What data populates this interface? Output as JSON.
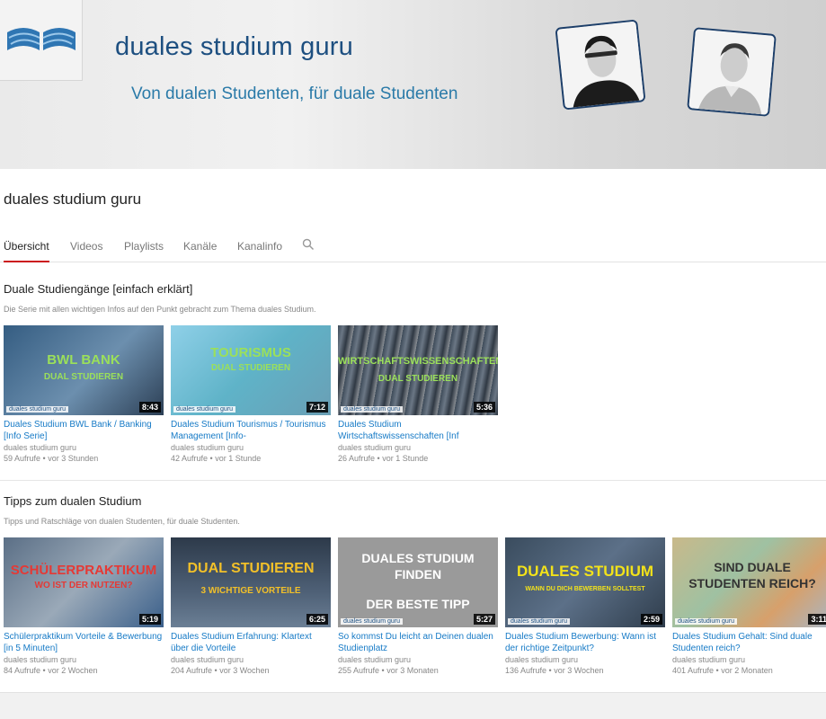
{
  "banner": {
    "brand": "duales studium guru",
    "slogan": "Von dualen Studenten, für duale Studenten"
  },
  "channel": {
    "title": "duales studium guru"
  },
  "tabs": [
    {
      "label": "Übersicht"
    },
    {
      "label": "Videos"
    },
    {
      "label": "Playlists"
    },
    {
      "label": "Kanäle"
    },
    {
      "label": "Kanalinfo"
    }
  ],
  "sections": [
    {
      "title": "Duale Studiengänge [einfach erklärt]",
      "description": "Die Serie mit allen wichtigen Infos auf den Punkt gebracht zum Thema duales Studium.",
      "videos": [
        {
          "thumb_line1": "BWL BANK",
          "thumb_line2": "DUAL STUDIEREN",
          "duration": "8:43",
          "thumb_mark": "duales studium guru",
          "title": "Duales Studium BWL Bank / Banking [Info Serie]",
          "channel": "duales studium guru",
          "views": "59 Aufrufe",
          "age": "vor 3 Stunden"
        },
        {
          "thumb_line1": "TOURISMUS",
          "thumb_line2": "DUAL STUDIEREN",
          "duration": "7:12",
          "thumb_mark": "duales studium guru",
          "title": "Duales Studium Tourismus / Tourismus Management [Info-",
          "channel": "duales studium guru",
          "views": "42 Aufrufe",
          "age": "vor 1 Stunde"
        },
        {
          "thumb_line1": "WIRTSCHAFTSWISSENSCHAFTEN",
          "thumb_line2": "DUAL STUDIEREN",
          "duration": "5:36",
          "thumb_mark": "duales studium guru",
          "title": "Duales Studium Wirtschaftswissenschaften [Inf",
          "channel": "duales studium guru",
          "views": "26 Aufrufe",
          "age": "vor 1 Stunde"
        }
      ]
    },
    {
      "title": "Tipps zum dualen Studium",
      "description": "Tipps und Ratschläge von dualen Studenten, für duale Studenten.",
      "videos": [
        {
          "thumb_line1": "SCHÜLERPRAKTIKUM",
          "thumb_line2": "WO IST DER NUTZEN?",
          "duration": "5:19",
          "thumb_mark": "",
          "title": "Schülerpraktikum Vorteile & Bewerbung [in 5 Minuten]",
          "channel": "duales studium guru",
          "views": "84 Aufrufe",
          "age": "vor 2 Wochen"
        },
        {
          "thumb_line1": "DUAL STUDIEREN",
          "thumb_line2": "3 WICHTIGE VORTEILE",
          "duration": "6:25",
          "thumb_mark": "",
          "title": "Duales Studium Erfahrung: Klartext über die Vorteile",
          "channel": "duales studium guru",
          "views": "204 Aufrufe",
          "age": "vor 3 Wochen"
        },
        {
          "thumb_line1": "DUALES STUDIUM FINDEN",
          "thumb_line2": "DER BESTE TIPP",
          "duration": "5:27",
          "thumb_mark": "duales studium guru",
          "title": "So kommst Du leicht an Deinen dualen Studienplatz",
          "channel": "duales studium guru",
          "views": "255 Aufrufe",
          "age": "vor 3 Monaten"
        },
        {
          "thumb_line1": "DUALES STUDIUM",
          "thumb_line2": "WANN DU DICH BEWERBEN SOLLTEST",
          "duration": "2:59",
          "thumb_mark": "duales studium guru",
          "title": "Duales Studium Bewerbung: Wann ist der richtige Zeitpunkt?",
          "channel": "duales studium guru",
          "views": "136 Aufrufe",
          "age": "vor 3 Wochen"
        },
        {
          "thumb_line1": "SIND DUALE STUDENTEN REICH?",
          "thumb_line2": "",
          "duration": "3:11",
          "thumb_mark": "duales studium guru",
          "title": "Duales Studium Gehalt: Sind duale Studenten reich?",
          "channel": "duales studium guru",
          "views": "401 Aufrufe",
          "age": "vor 2 Monaten"
        }
      ]
    }
  ],
  "colors": {
    "brand": "#1d4f80",
    "slogan": "#2a7aa8",
    "link": "#167ac6",
    "tab_active": "#cc181e"
  }
}
